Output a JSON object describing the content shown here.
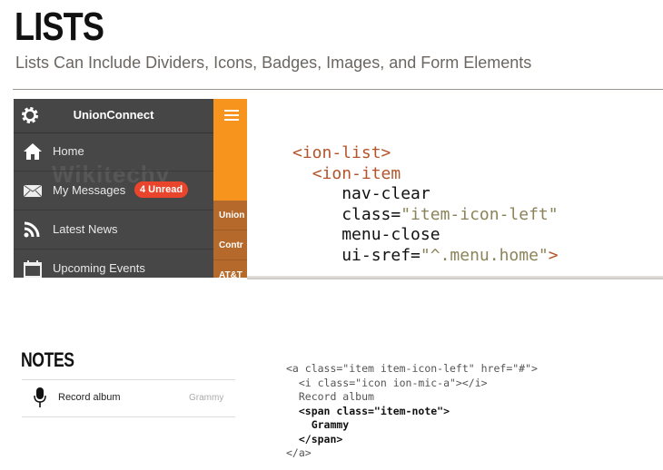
{
  "header": {
    "title": "LISTS",
    "subtitle": "Lists Can Include Dividers, Icons, Badges, Images, and Form Elements"
  },
  "phone": {
    "app_title": "UnionConnect",
    "watermark": "Wikitechy",
    "menu_items": [
      {
        "label": "Home",
        "icon": "home-icon"
      },
      {
        "label": "My Messages",
        "icon": "envelope-icon",
        "badge": "4 Unread"
      },
      {
        "label": "Latest News",
        "icon": "rss-icon"
      },
      {
        "label": "Upcoming Events",
        "icon": "calendar-icon"
      }
    ],
    "side_items": [
      "Union",
      "Contr",
      "AT&T"
    ],
    "colors": {
      "menu_bg": "#474747",
      "accent": "#f7941d",
      "side_list": "#b5692b",
      "badge": "#e8452c"
    }
  },
  "code_top": {
    "line1": "<ion-list>",
    "line2": "<ion-item",
    "line3": "nav-clear",
    "line4_attr": "class=",
    "line4_val": "\"item-icon-left\"",
    "line5": "menu-close",
    "line6_attr": "ui-sref=",
    "line6_val": "\"^.menu.home\"",
    "line6_end": ">"
  },
  "notes": {
    "title": "NOTES",
    "item_label": "Record album",
    "item_note": "Grammy"
  },
  "code_bottom": {
    "line1": "<a class=\"item item-icon-left\" href=\"#\">",
    "line2": "  <i class=\"icon ion-mic-a\"></i>",
    "line3": "  Record album",
    "line4": "  <span class=\"item-note\">",
    "line5": "    Grammy",
    "line6": "  </span>",
    "line7": "</a>"
  }
}
